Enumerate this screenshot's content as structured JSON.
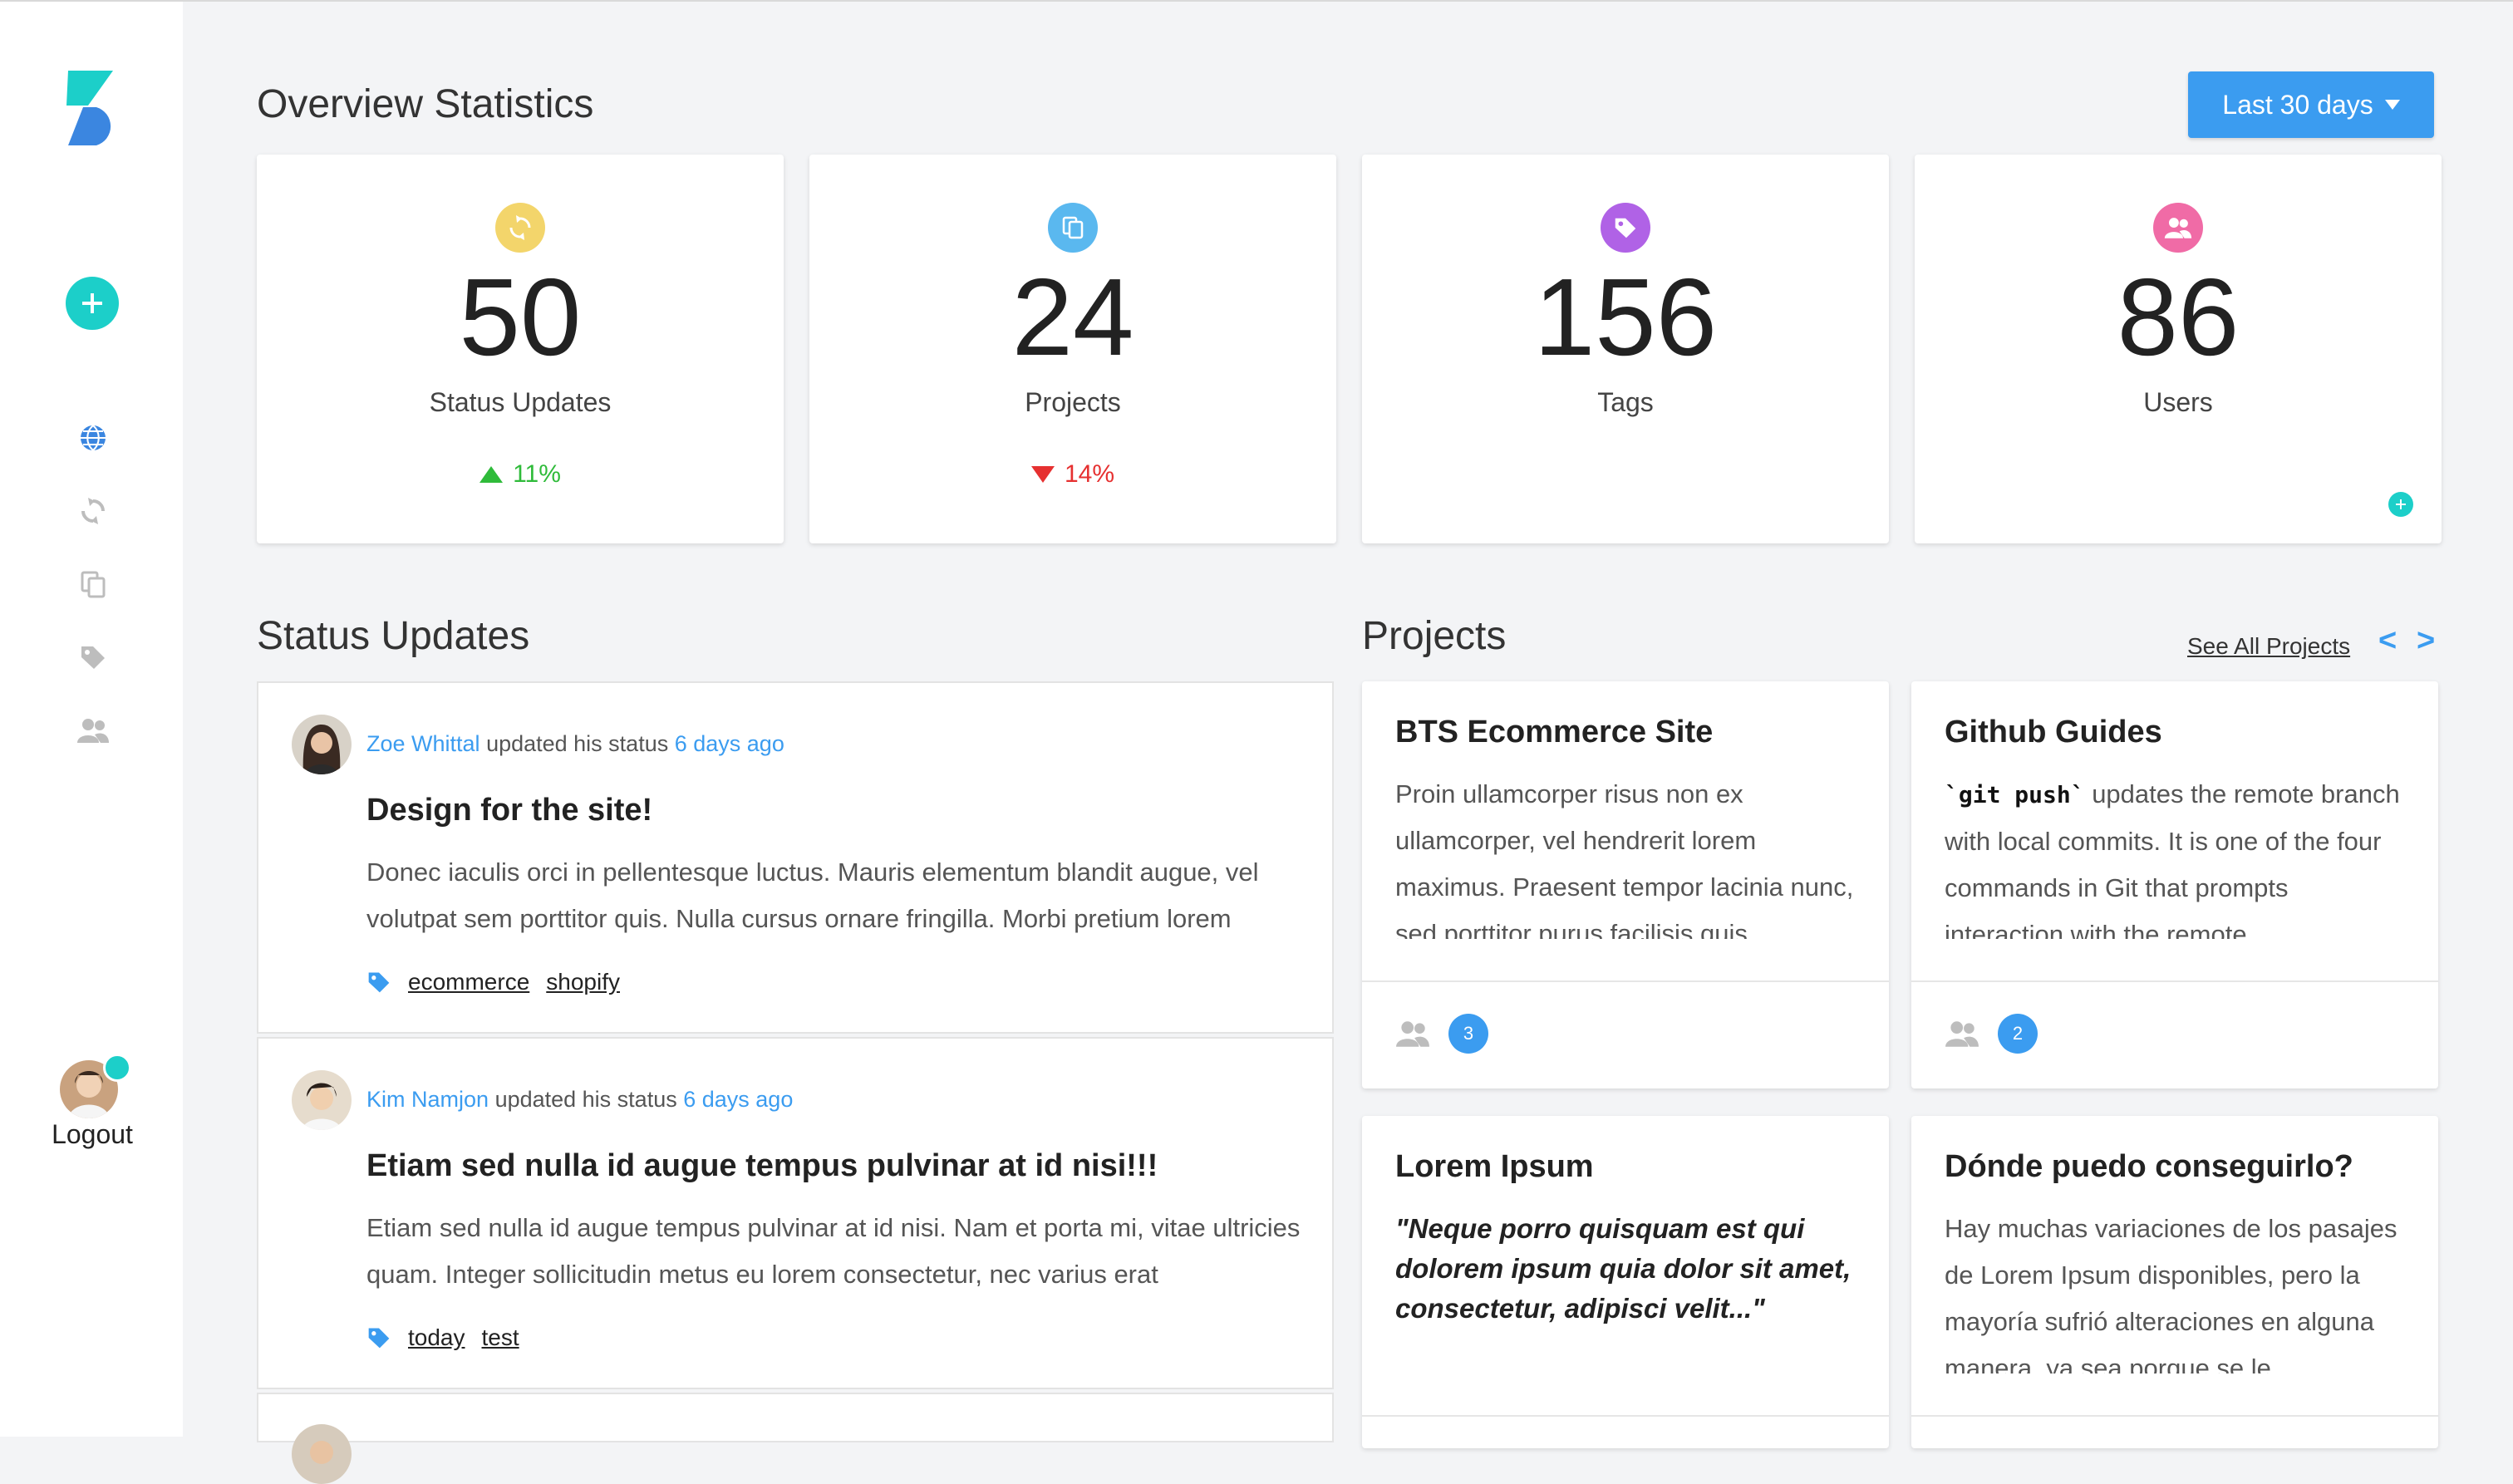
{
  "sidebar": {
    "logout_label": "Logout",
    "nav": [
      "globe-icon",
      "status-updates-icon",
      "projects-icon",
      "tags-icon",
      "users-icon"
    ]
  },
  "header": {
    "title": "Overview Statistics",
    "range_button": "Last 30 days"
  },
  "stats": [
    {
      "value": "50",
      "label": "Status Updates",
      "change": "11%",
      "direction": "up",
      "icon_color": "#f3d56b"
    },
    {
      "value": "24",
      "label": "Projects",
      "change": "14%",
      "direction": "down",
      "icon_color": "#5ab8ef"
    },
    {
      "value": "156",
      "label": "Tags",
      "change": "",
      "icon_color": "#b062e6"
    },
    {
      "value": "86",
      "label": "Users",
      "change": "",
      "icon_color": "#f06ba6"
    }
  ],
  "status_section": {
    "title": "Status Updates"
  },
  "status_updates": [
    {
      "author": "Zoe Whittal",
      "action": "updated his status",
      "time": "6 days ago",
      "title": "Design for the site!",
      "body": "Donec iaculis orci in pellentesque luctus. Mauris elementum blandit augue, vel volutpat sem porttitor quis. Nulla cursus ornare fringilla. Morbi pretium lorem",
      "tags": [
        "ecommerce",
        "shopify"
      ]
    },
    {
      "author": "Kim Namjon",
      "action": "updated his status",
      "time": "6 days ago",
      "title": "Etiam sed nulla id augue tempus pulvinar at id nisi!!!",
      "body": "Etiam sed nulla id augue tempus pulvinar at id nisi. Nam et porta mi, vitae ultricies quam. Integer sollicitudin metus eu lorem consectetur, nec varius erat",
      "tags": [
        "today",
        "test"
      ]
    }
  ],
  "projects_section": {
    "title": "Projects",
    "see_all": "See All Projects",
    "prev": "<",
    "next": ">"
  },
  "projects": [
    {
      "title": "BTS Ecommerce Site",
      "body": "Proin ullamcorper risus non ex ullamcorper, vel hendrerit lorem maximus. Praesent tempor lacinia nunc, sed porttitor purus facilisis quis.",
      "members": "3"
    },
    {
      "title": "Github Guides",
      "code": "`git push`",
      "body": " updates the remote branch with local commits. It is one of the four commands in Git that prompts interaction with the remote",
      "members": "2"
    },
    {
      "title": "Lorem Ipsum",
      "body": "\"Neque porro quisquam est qui dolorem ipsum quia dolor sit amet, consectetur, adipisci velit...\""
    },
    {
      "title": "Dónde puedo conseguirlo?",
      "body": "Hay muchas variaciones de los pasajes de Lorem Ipsum disponibles, pero la mayoría sufrió alteraciones en alguna manera, ya sea porque se le"
    }
  ]
}
